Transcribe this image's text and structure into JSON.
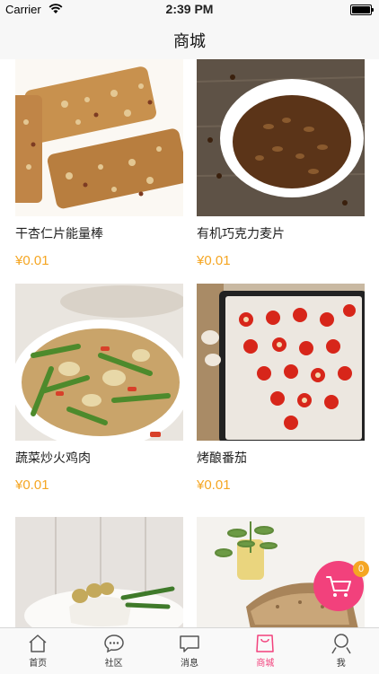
{
  "status_bar": {
    "carrier": "Carrier",
    "time": "2:39 PM"
  },
  "nav": {
    "title": "商城"
  },
  "products": [
    {
      "name": "干杏仁片能量棒",
      "price": "¥0.01"
    },
    {
      "name": "有机巧克力麦片",
      "price": "¥0.01"
    },
    {
      "name": "蔬菜炒火鸡肉",
      "price": "¥0.01"
    },
    {
      "name": "烤酿番茄",
      "price": "¥0.01"
    },
    {
      "name": "",
      "price": ""
    },
    {
      "name": "",
      "price": ""
    }
  ],
  "cart": {
    "badge": "0",
    "icon": "cart-icon"
  },
  "tabs": [
    {
      "label": "首页",
      "icon": "home-icon"
    },
    {
      "label": "社区",
      "icon": "community-icon"
    },
    {
      "label": "消息",
      "icon": "message-icon"
    },
    {
      "label": "商城",
      "icon": "shop-bag-icon",
      "active": true
    },
    {
      "label": "我",
      "icon": "user-icon"
    }
  ],
  "colors": {
    "accent": "#f2417c",
    "price": "#f5a623"
  }
}
